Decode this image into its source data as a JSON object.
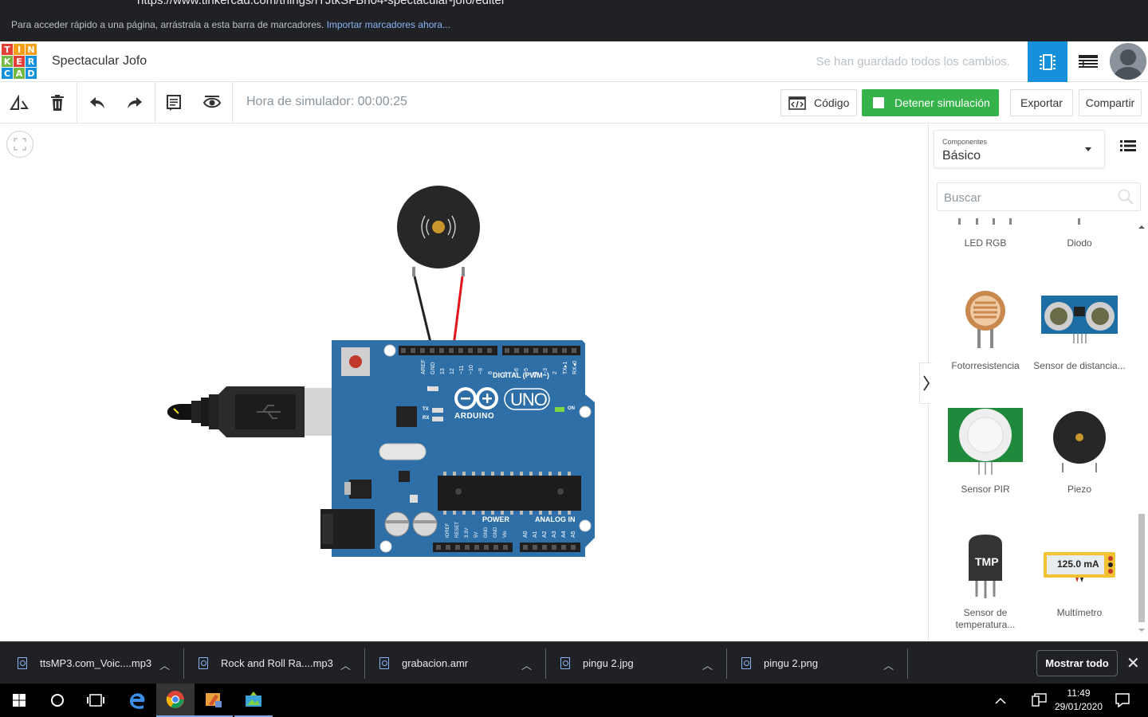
{
  "browser": {
    "url": "https://www.tinkercad.com/things/fTJtkSFBn04-spectacular-jofo/editel",
    "bookmark_prompt": "Para acceder rápido a una página, arrástrala a esta barra de marcadores.",
    "bookmark_link": "Importar marcadores ahora..."
  },
  "header": {
    "logo_letters": [
      "T",
      "I",
      "N",
      "K",
      "E",
      "R",
      "C",
      "A",
      "D"
    ],
    "project_name": "Spectacular Jofo",
    "save_status": "Se han guardado todos los cambios."
  },
  "toolbar": {
    "sim_time": "Hora de simulador: 00:00:25",
    "code_label": "Código",
    "stop_sim_label": "Detener simulación",
    "export_label": "Exportar",
    "share_label": "Compartir"
  },
  "board": {
    "digital_label": "DIGITAL (PWM~)",
    "brand": "ARDUINO",
    "model": "UNO",
    "power_label": "POWER",
    "analog_label": "ANALOG IN",
    "on_label": "ON",
    "tx_label": "TX",
    "rx_label": "RX",
    "l_label": "L",
    "top_pins": [
      "AREF",
      "GND",
      "13",
      "12",
      "~11",
      "~10",
      "~9",
      "8",
      "7",
      "~6",
      "~5",
      "4",
      "~3",
      "2",
      "TX▸1",
      "RX◂0"
    ],
    "bottom_pins": [
      "IOREF",
      "RESET",
      "3.3V",
      "5V",
      "GND",
      "GND",
      "Vin",
      "A0",
      "A1",
      "A2",
      "A3",
      "A4",
      "A5"
    ]
  },
  "panel": {
    "components_caption": "Componentes",
    "components_value": "Básico",
    "search_placeholder": "Buscar",
    "components": [
      {
        "label": "LED RGB"
      },
      {
        "label": "Diodo"
      },
      {
        "label": "Fotorresistencia"
      },
      {
        "label": "Sensor de distancia..."
      },
      {
        "label": "Sensor PIR"
      },
      {
        "label": "Piezo"
      },
      {
        "label": "Sensor de temperatura..."
      },
      {
        "label": "Multímetro"
      }
    ],
    "tmp_text": "TMP",
    "multimeter_reading": "125.0 mA"
  },
  "downloads": {
    "items": [
      {
        "name": "ttsMP3.com_Voic....mp3"
      },
      {
        "name": "Rock and Roll Ra....mp3"
      },
      {
        "name": "grabacion.amr"
      },
      {
        "name": "pingu 2.jpg"
      },
      {
        "name": "pingu 2.png"
      }
    ],
    "show_all": "Mostrar todo"
  },
  "taskbar": {
    "time": "11:49",
    "date": "29/01/2020"
  },
  "colors": {
    "accent_blue": "#1591db",
    "sim_green": "#35b24a",
    "arduino_blue": "#2f6fa8"
  }
}
